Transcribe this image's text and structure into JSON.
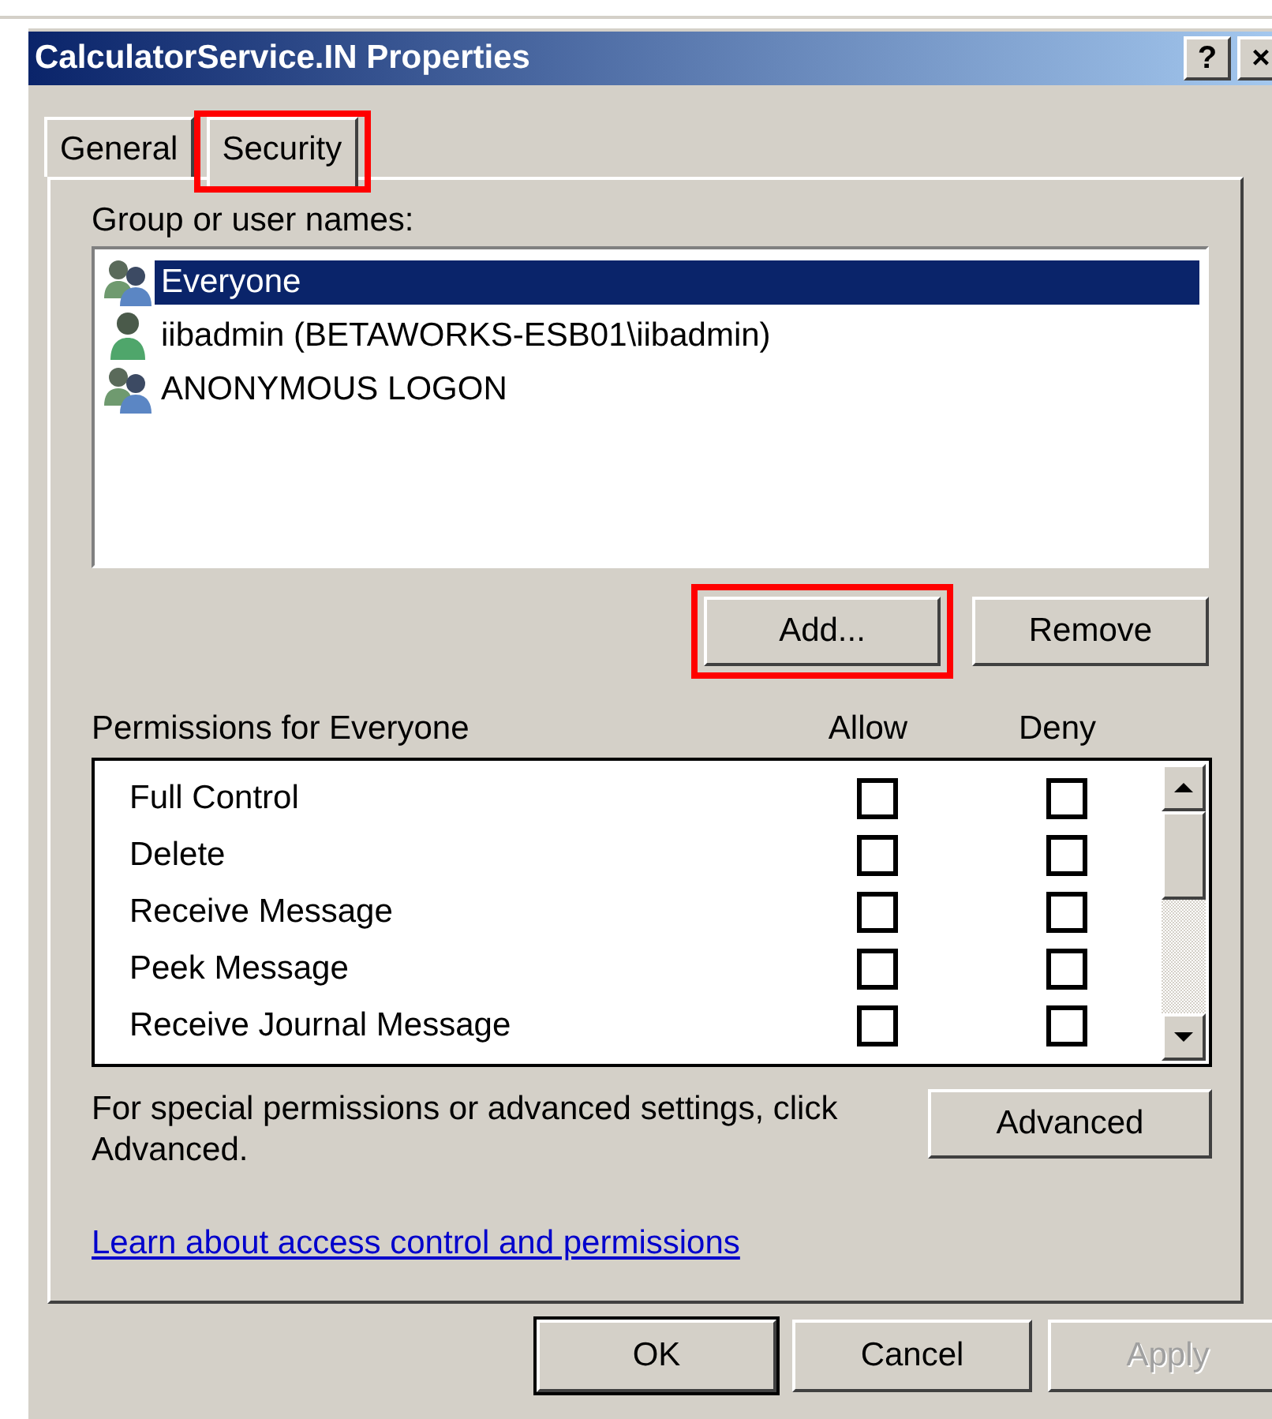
{
  "window": {
    "title": "CalculatorService.IN Properties",
    "title_buttons": [
      "?",
      "×"
    ]
  },
  "tabs": [
    {
      "label": "General",
      "selected": false,
      "highlighted": false
    },
    {
      "label": "Security",
      "selected": true,
      "highlighted": true
    }
  ],
  "groups": {
    "label": "Group or user names:",
    "items": [
      {
        "name": "Everyone",
        "kind": "group",
        "selected": true
      },
      {
        "name": "iibadmin (BETAWORKS-ESB01\\iibadmin)",
        "kind": "user",
        "selected": false
      },
      {
        "name": "ANONYMOUS LOGON",
        "kind": "group",
        "selected": false
      }
    ]
  },
  "group_buttons": [
    {
      "label": "Add...",
      "highlighted": true
    },
    {
      "label": "Remove",
      "highlighted": false
    }
  ],
  "permissions": {
    "label": "Permissions for Everyone",
    "columns": [
      "Allow",
      "Deny"
    ],
    "rows": [
      {
        "name": "Full Control",
        "allow": false,
        "deny": false
      },
      {
        "name": "Delete",
        "allow": false,
        "deny": false
      },
      {
        "name": "Receive Message",
        "allow": false,
        "deny": false
      },
      {
        "name": "Peek Message",
        "allow": false,
        "deny": false
      },
      {
        "name": "Receive Journal Message",
        "allow": false,
        "deny": false
      }
    ]
  },
  "advanced": {
    "text": "For special permissions or advanced settings, click Advanced.",
    "button": "Advanced"
  },
  "link": "Learn about access control and permissions",
  "buttons": [
    {
      "label": "OK",
      "default": true,
      "disabled": false
    },
    {
      "label": "Cancel",
      "default": false,
      "disabled": false
    },
    {
      "label": "Apply",
      "default": false,
      "disabled": true
    }
  ]
}
